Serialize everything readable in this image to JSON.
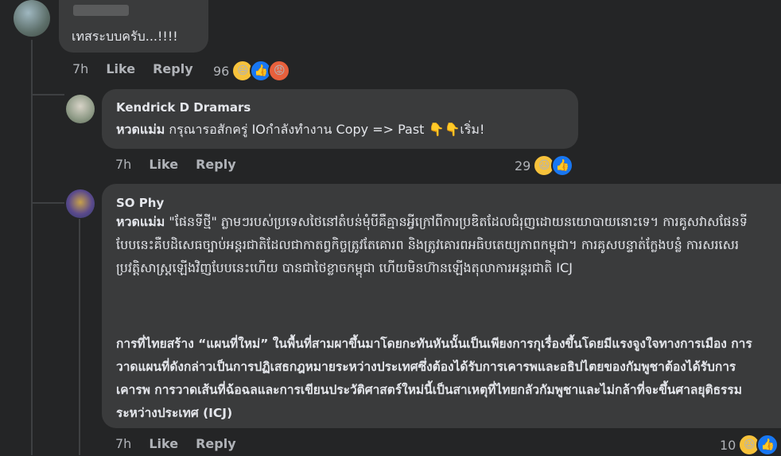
{
  "comment1": {
    "text": "เทสระบบครับ...!!!!",
    "time": "7h",
    "like_label": "Like",
    "reply_label": "Reply",
    "reaction_count": "96",
    "reactions": [
      "haha",
      "like",
      "angry"
    ]
  },
  "reply1": {
    "author": "Kendrick D Dramars",
    "mention": "หวดแม่ม",
    "text": "กรุณารอสักครู่ IOกำลังทำงาน Copy => Past 👇👇เริ่ม!",
    "time": "7h",
    "like_label": "Like",
    "reply_label": "Reply",
    "reaction_count": "29",
    "reactions": [
      "haha",
      "like"
    ]
  },
  "reply2": {
    "author": "SO Phy",
    "mention": "หวดแม่ม",
    "text_khmer": "\"ផែនទីថ្មី\" ភ្លាមៗរបស់ប្រទេសថៃនៅតំបន់មុំបីគឺគ្មានអ្វីក្រៅពីការប្រឌិតដែលជំរុញដោយនយោបាយនោះទេ។ ការគូសវាសផែនទីបែបនេះគឺបដិសេធច្បាប់អន្តរជាតិដែលជាកាតព្វកិច្ចត្រូវតែគោរព និងត្រូវគោរពអធិបតេយ្យភាពកម្ពុជា។ ការគូសបន្ទាត់ក្លែងបន្លំ ការសរសេរប្រវត្តិសាស្ត្រឡើងវិញបែបនេះហើយ បានជាថៃខ្លាចកម្ពុជា ហើយមិនហ៊ានឡើងតុលាការអន្តរជាតិ ICJ",
    "text_thai": "การที่ไทยสร้าง “แผนที่ใหม่” ในพื้นที่สามผาขึ้นมาโดยกะทันหันนั้นเป็นเพียงการกุเรื่องขึ้นโดยมีแรงจูงใจทางการเมือง การวาดแผนที่ดังกล่าวเป็นการปฏิเสธกฎหมายระหว่างประเทศซึ่งต้องได้รับการเคารพและอธิปไตยของกัมพูชาต้องได้รับการเคารพ การวาดเส้นที่ฉ้อฉลและการเขียนประวัติศาสตร์ใหม่นี้เป็นสาเหตุที่ไทยกลัวกัมพูชาและไม่กล้าที่จะขึ้นศาลยุติธรรมระหว่างประเทศ (ICJ)",
    "time": "7h",
    "like_label": "Like",
    "reply_label": "Reply",
    "reaction_count": "10",
    "reactions": [
      "haha",
      "like"
    ]
  },
  "colors": {
    "background": "#242526",
    "bubble": "#3a3b3c",
    "text": "#e4e6eb",
    "meta": "#b0b3b8",
    "like_blue": "#1877f2",
    "haha_yellow": "#f7c23b"
  }
}
